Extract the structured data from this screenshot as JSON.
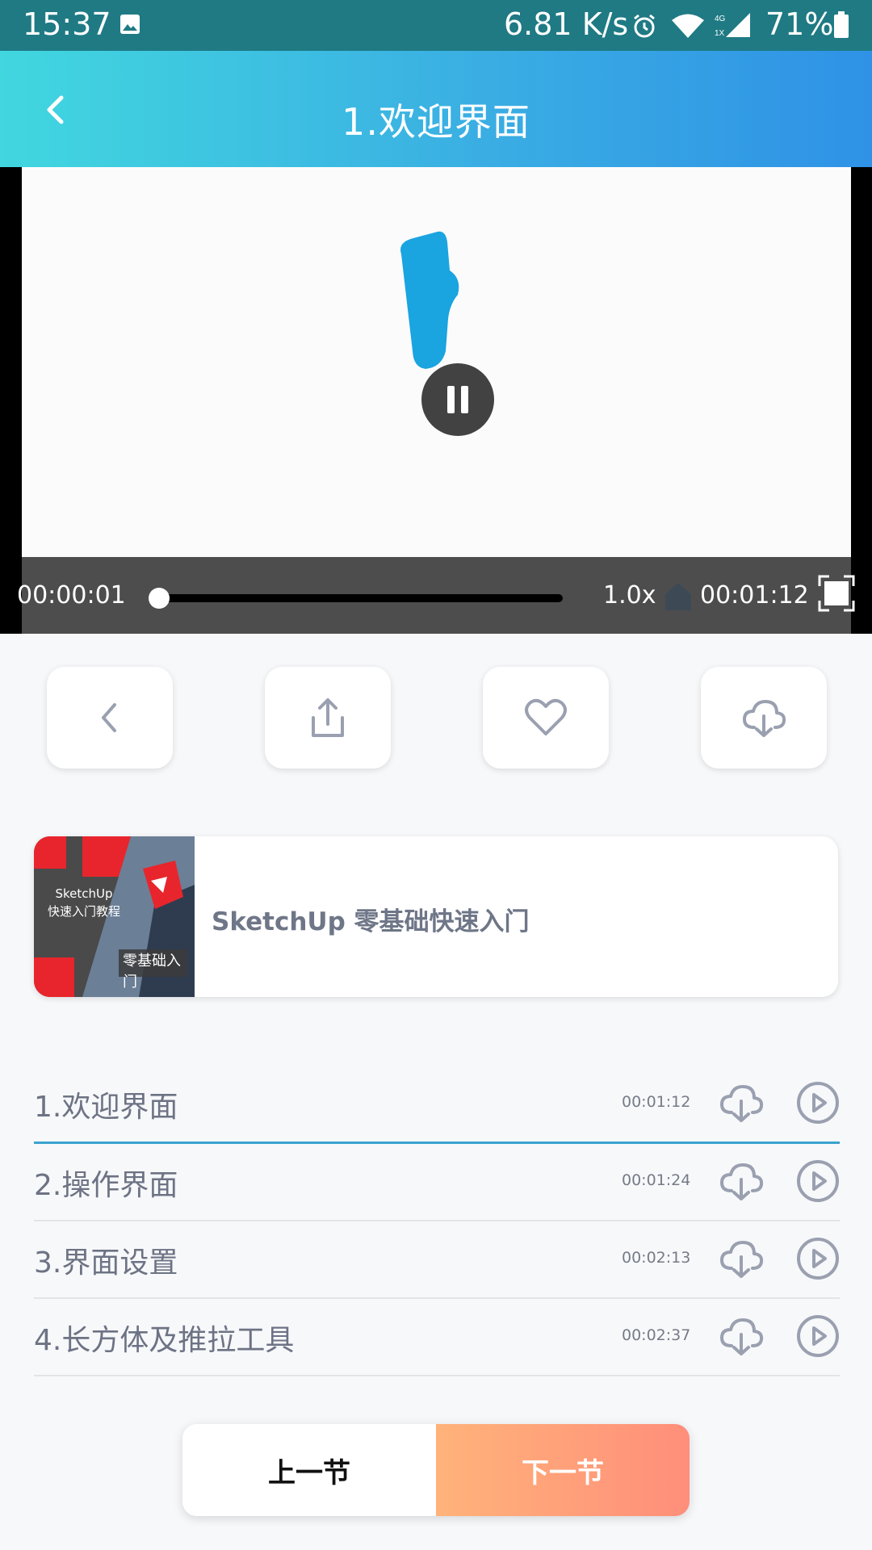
{
  "status_bar": {
    "time": "15:37",
    "network_speed": "6.81 K/s",
    "battery": "71%"
  },
  "header": {
    "title": "1.欢迎界面"
  },
  "player": {
    "current_time": "00:00:01",
    "total_time": "00:01:12",
    "speed": "1.0x",
    "progress_fraction": 0.0
  },
  "course": {
    "title": "SketchUp 零基础快速入门",
    "thumb_line1": "SketchUp",
    "thumb_line2": "快速入门教程",
    "thumb_badge": "零基础入门"
  },
  "lessons": [
    {
      "title": "1.欢迎界面",
      "duration": "00:01:12",
      "active": true
    },
    {
      "title": "2.操作界面",
      "duration": "00:01:24",
      "active": false
    },
    {
      "title": "3.界面设置",
      "duration": "00:02:13",
      "active": false
    },
    {
      "title": "4.长方体及推拉工具",
      "duration": "00:02:37",
      "active": false
    }
  ],
  "nav": {
    "prev_label": "上一节",
    "next_label": "下一节"
  },
  "colors": {
    "accent": "#3aa3cf",
    "header_start": "#41d7df",
    "header_end": "#2f92e6",
    "next_start": "#ffb37a",
    "next_end": "#ff8e7a"
  },
  "icons": [
    "back-icon",
    "share-icon",
    "favorite-icon",
    "download-icon",
    "play-icon",
    "pause-icon",
    "fullscreen-icon",
    "cast-icon"
  ]
}
